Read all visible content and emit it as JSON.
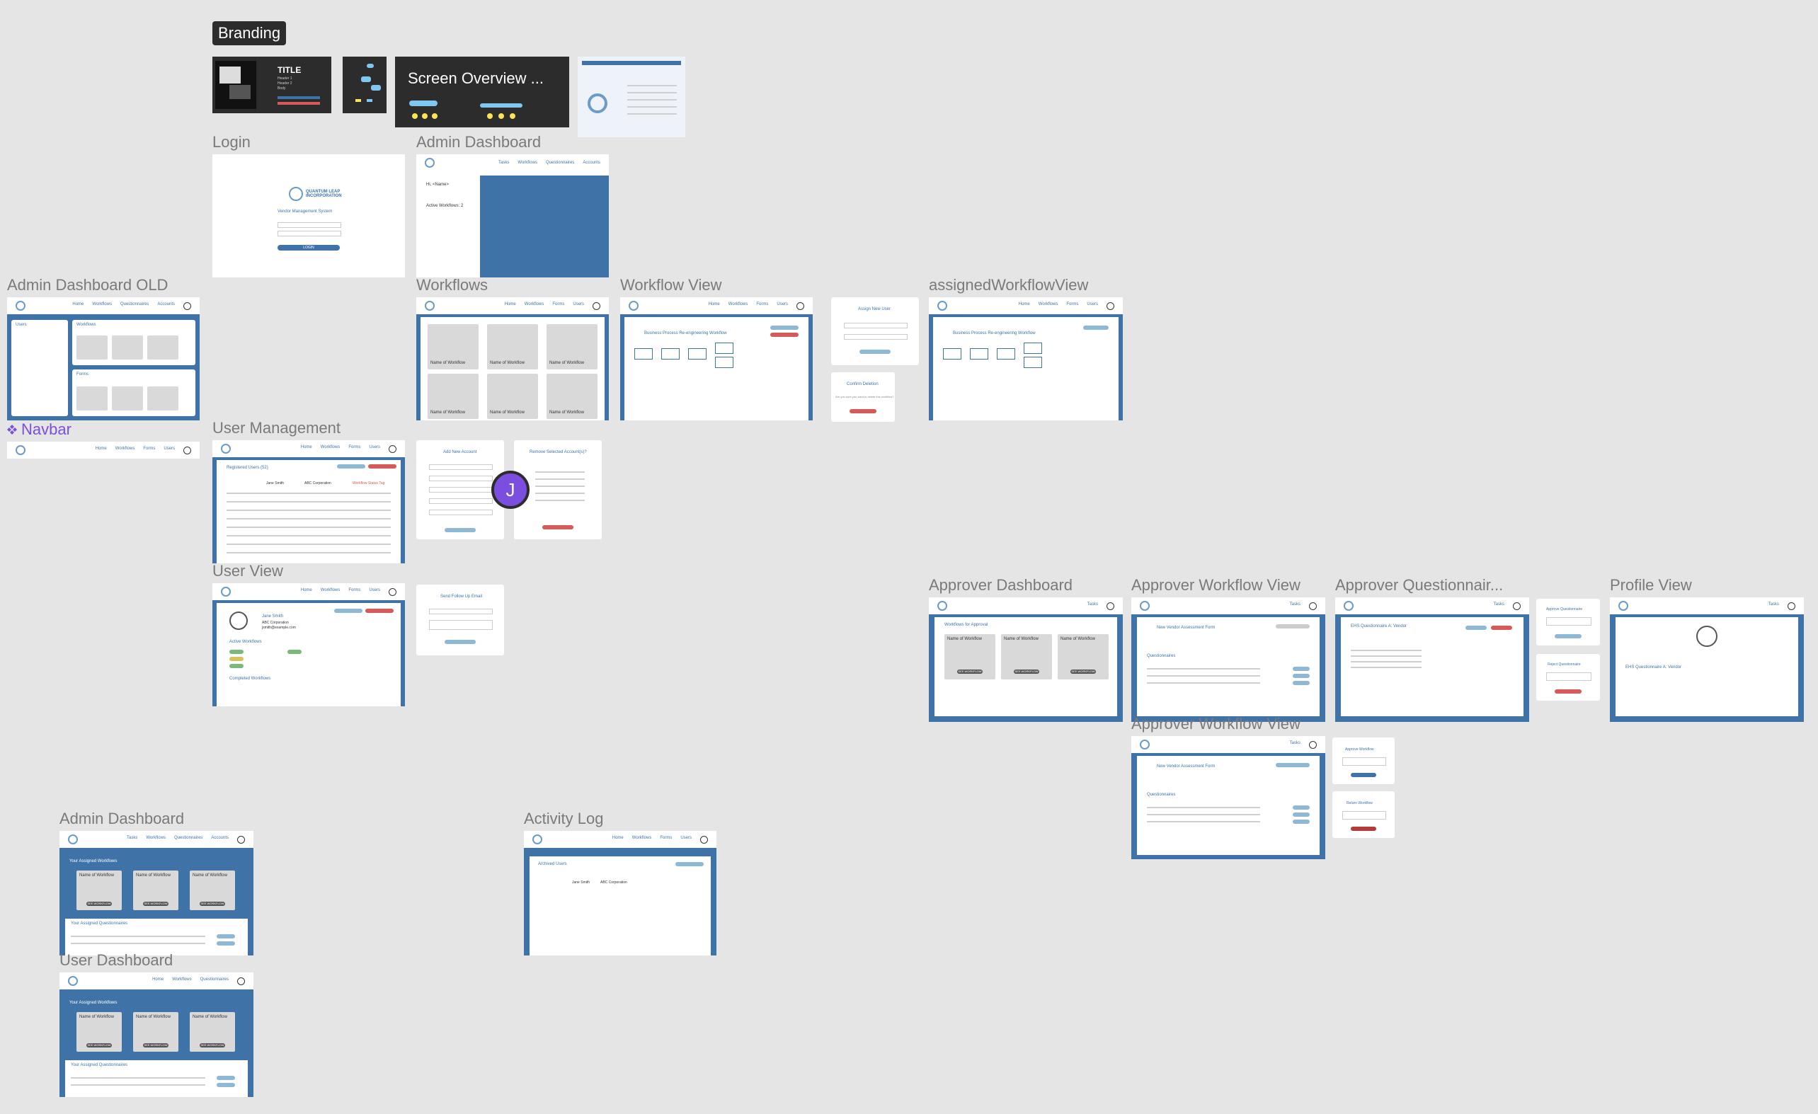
{
  "canvas": {
    "background": "#e5e5e5",
    "accent_blue": "#3f73a8",
    "collab_color": "#7b4ee0"
  },
  "sections": {
    "branding": "Branding"
  },
  "thumbnails": {
    "title_card": {
      "title": "TITLE",
      "lines": [
        "Header 1",
        "Header 2",
        "Body"
      ]
    },
    "screen_overview": "Screen Overview ..."
  },
  "frames": {
    "login": {
      "label": "Login",
      "title": "QUANTUM LEAP INCORPORATION",
      "subtitle": "Vendor Management System",
      "button": "LOGIN"
    },
    "admin_dashboard_top": {
      "label": "Admin Dashboard",
      "greeting": "Hi, <Name>",
      "active": "Active Workflows: 2",
      "nav": [
        "Tasks",
        "Workflows",
        "Questionnaires",
        "Accounts"
      ]
    },
    "admin_dashboard_old": {
      "label": "Admin Dashboard OLD",
      "nav": [
        "Home",
        "Workflows",
        "Questionnaires",
        "Accounts"
      ],
      "sections": [
        "Users",
        "Workflows",
        "Forms"
      ]
    },
    "workflows": {
      "label": "Workflows",
      "nav": [
        "Home",
        "Workflows",
        "Forms",
        "Users"
      ],
      "card": "Name of Workflow"
    },
    "workflow_view": {
      "label": "Workflow View",
      "heading": "Business Process Re-engineering Workflow",
      "nav": [
        "Home",
        "Workflows",
        "Forms",
        "Users"
      ]
    },
    "assign_new_user": {
      "title": "Assign New User"
    },
    "confirm_deletion": {
      "title": "Confirm Deletion",
      "body": "Are you sure you want to delete this workflow?",
      "button": "Delete Workflow"
    },
    "assigned_workflow_view": {
      "label": "assignedWorkflowView",
      "heading": "Business Process Re-engineering Workflow",
      "nav": [
        "Home",
        "Workflows",
        "Forms",
        "Users"
      ]
    },
    "navbar_component": {
      "label": "Navbar",
      "nav": [
        "Home",
        "Workflows",
        "Forms",
        "Users"
      ]
    },
    "user_management": {
      "label": "User Management",
      "heading": "Registered Users (52)",
      "nav": [
        "Home",
        "Workflows",
        "Forms",
        "Users"
      ],
      "row_name": "Jane Smith",
      "row_company": "ABC Corporation",
      "row_tag": "Workflow Status Tag"
    },
    "add_account": {
      "title": "Add New Account"
    },
    "remove_account": {
      "title": "Remove Selected Account(s)?"
    },
    "user_view": {
      "label": "User View",
      "name": "Jane Smith",
      "company": "ABC Corporation",
      "email": "jsmith@example.com",
      "active": "Active Workflows",
      "completed": "Completed Workflows",
      "nav": [
        "Home",
        "Workflows",
        "Forms",
        "Users"
      ]
    },
    "send_email": {
      "title": "Send Follow Up Email"
    },
    "approver_dashboard": {
      "label": "Approver Dashboard",
      "heading": "Workflows for Approval",
      "card": "Name of Workflow",
      "button": "SEE WORKFLOW",
      "nav": [
        "Tasks"
      ]
    },
    "approver_workflow_view": {
      "label": "Approver Workflow View",
      "heading": "New Vendor Assessment Form",
      "section": "Questionnaires",
      "nav": [
        "Tasks"
      ]
    },
    "approver_questionnaire": {
      "label": "Approver Questionnair...",
      "heading": "EHS Questionnaire A: Vendor",
      "nav": [
        "Tasks"
      ]
    },
    "approve_questionnaire": {
      "title": "Approve Questionnaire"
    },
    "reject_questionnaire": {
      "title": "Reject Questionnaire"
    },
    "profile_view": {
      "label": "Profile View",
      "heading": "EHS Questionnaire A: Vendor",
      "nav": [
        "Tasks"
      ]
    },
    "approver_workflow_view_2": {
      "label": "Approver Workflow View",
      "heading": "New Vendor Assessment Form",
      "section": "Questionnaires",
      "nav": [
        "Tasks"
      ]
    },
    "approve_workflow": {
      "title": "Approve Workflow"
    },
    "return_workflow": {
      "title": "Return Workflow"
    },
    "admin_dashboard_bottom": {
      "label": "Admin Dashboard",
      "heading": "Your Assigned Workflows",
      "card": "Name of Workflow",
      "button": "SEE WORKFLOW",
      "section": "Your Assigned Questionnaires",
      "nav": [
        "Tasks",
        "Workflows",
        "Questionnaires",
        "Accounts"
      ]
    },
    "user_dashboard": {
      "label": "User Dashboard",
      "heading": "Your Assigned Workflows",
      "card": "Name of Workflow",
      "button": "SEE WORKFLOW",
      "section": "Your Assigned Questionnaires",
      "nav": [
        "Home",
        "Workflows",
        "Questionnaires"
      ]
    },
    "activity_log": {
      "label": "Activity Log",
      "heading": "Archived Users",
      "nav": [
        "Home",
        "Workflows",
        "Forms",
        "Users"
      ],
      "row_name": "Jane Smith",
      "row_company": "ABC Corporation"
    }
  },
  "collaborator": {
    "initial": "J"
  }
}
